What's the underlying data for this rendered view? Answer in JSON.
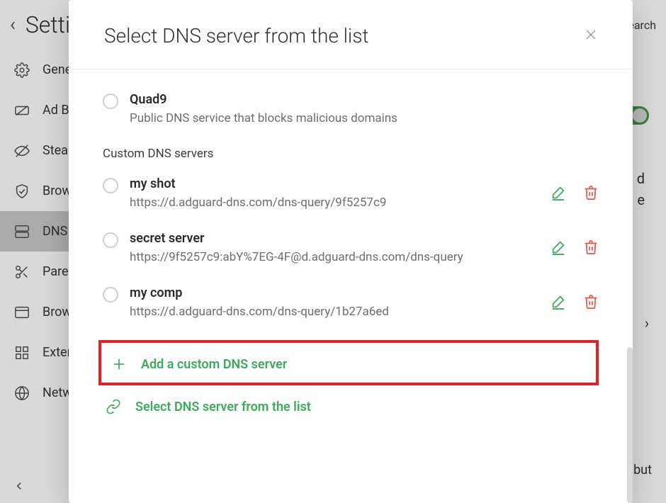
{
  "header": {
    "title": "Settings",
    "search_label": "search"
  },
  "sidebar": {
    "items": [
      {
        "label": "General"
      },
      {
        "label": "Ad Blocker"
      },
      {
        "label": "Stealth Mode"
      },
      {
        "label": "Browsing Security"
      },
      {
        "label": "DNS Protection"
      },
      {
        "label": "Parental Control"
      },
      {
        "label": "Browser Assistant"
      },
      {
        "label": "Extensions"
      },
      {
        "label": "Network"
      }
    ]
  },
  "main": {
    "trail_text": ", but"
  },
  "modal": {
    "title": "Select DNS server from the list",
    "public_servers": [
      {
        "name": "Quad9",
        "desc": "Public DNS service that blocks malicious domains"
      }
    ],
    "custom_section_label": "Custom DNS servers",
    "custom_servers": [
      {
        "name": "my shot",
        "desc": "https://d.adguard-dns.com/dns-query/9f5257c9"
      },
      {
        "name": "secret server",
        "desc": "https://9f5257c9:abY%7EG-4F@d.adguard-dns.com/dns-query"
      },
      {
        "name": "my comp",
        "desc": "https://d.adguard-dns.com/dns-query/1b27a6ed"
      }
    ],
    "add_custom_label": "Add a custom DNS server",
    "select_from_list_label": "Select DNS server from the list"
  }
}
